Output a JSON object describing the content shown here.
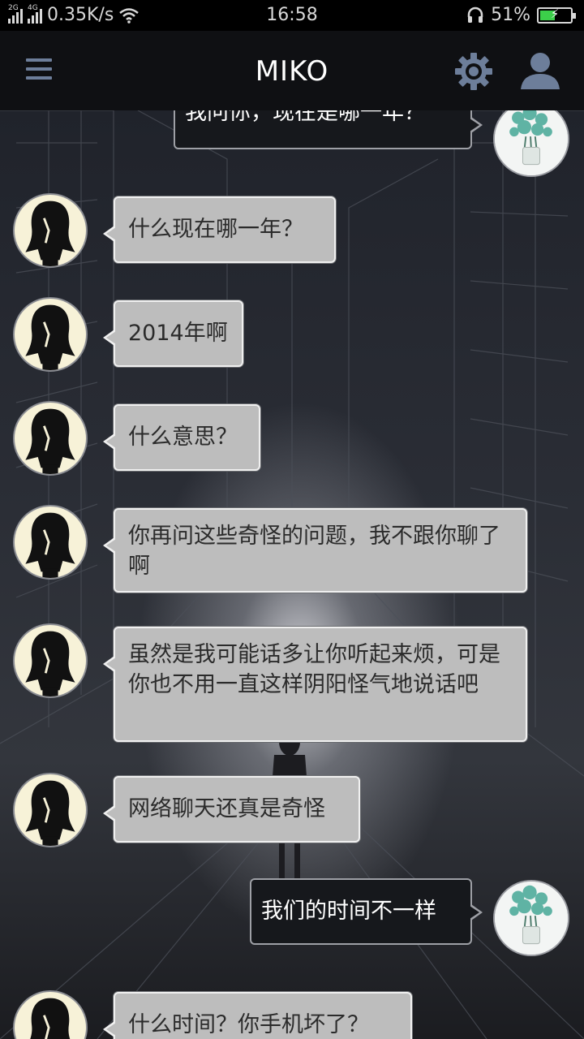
{
  "status_bar": {
    "net_left": "2G",
    "net_right": "4G",
    "speed": "0.35K/s",
    "time": "16:58",
    "battery_percent": "51%",
    "battery_level": 0.51,
    "icons": [
      "signal-icon",
      "wifi-icon",
      "headset-icon",
      "battery-charging-icon"
    ]
  },
  "header": {
    "title": "MIKO",
    "icons": [
      "menu-icon",
      "gear-icon",
      "user-icon"
    ],
    "accent": "#6d7e9a"
  },
  "messages": [
    {
      "side": "right",
      "text": "我问你，现在是哪一年？",
      "avatar": "flower-vase-avatar"
    },
    {
      "side": "left",
      "text": "什么现在哪一年？",
      "avatar": "girl-silhouette-avatar"
    },
    {
      "side": "left",
      "text": "2014年啊",
      "avatar": "girl-silhouette-avatar"
    },
    {
      "side": "left",
      "text": "什么意思？",
      "avatar": "girl-silhouette-avatar"
    },
    {
      "side": "left",
      "text": "你再问这些奇怪的问题，我不跟你聊了啊",
      "avatar": "girl-silhouette-avatar"
    },
    {
      "side": "left",
      "text": "虽然是我可能话多让你听起来烦，可是你也不用一直这样阴阳怪气地说话吧",
      "avatar": "girl-silhouette-avatar"
    },
    {
      "side": "left",
      "text": "网络聊天还真是奇怪",
      "avatar": "girl-silhouette-avatar"
    },
    {
      "side": "right",
      "text": "我们的时间不一样",
      "avatar": "flower-vase-avatar"
    },
    {
      "side": "left",
      "text": "什么时间？你手机坏了？",
      "avatar": "girl-silhouette-avatar"
    }
  ],
  "colors": {
    "left_bubble": "#bdbdbd",
    "right_bubble": "#16181c",
    "battery_fill": "#3ccf4a"
  }
}
